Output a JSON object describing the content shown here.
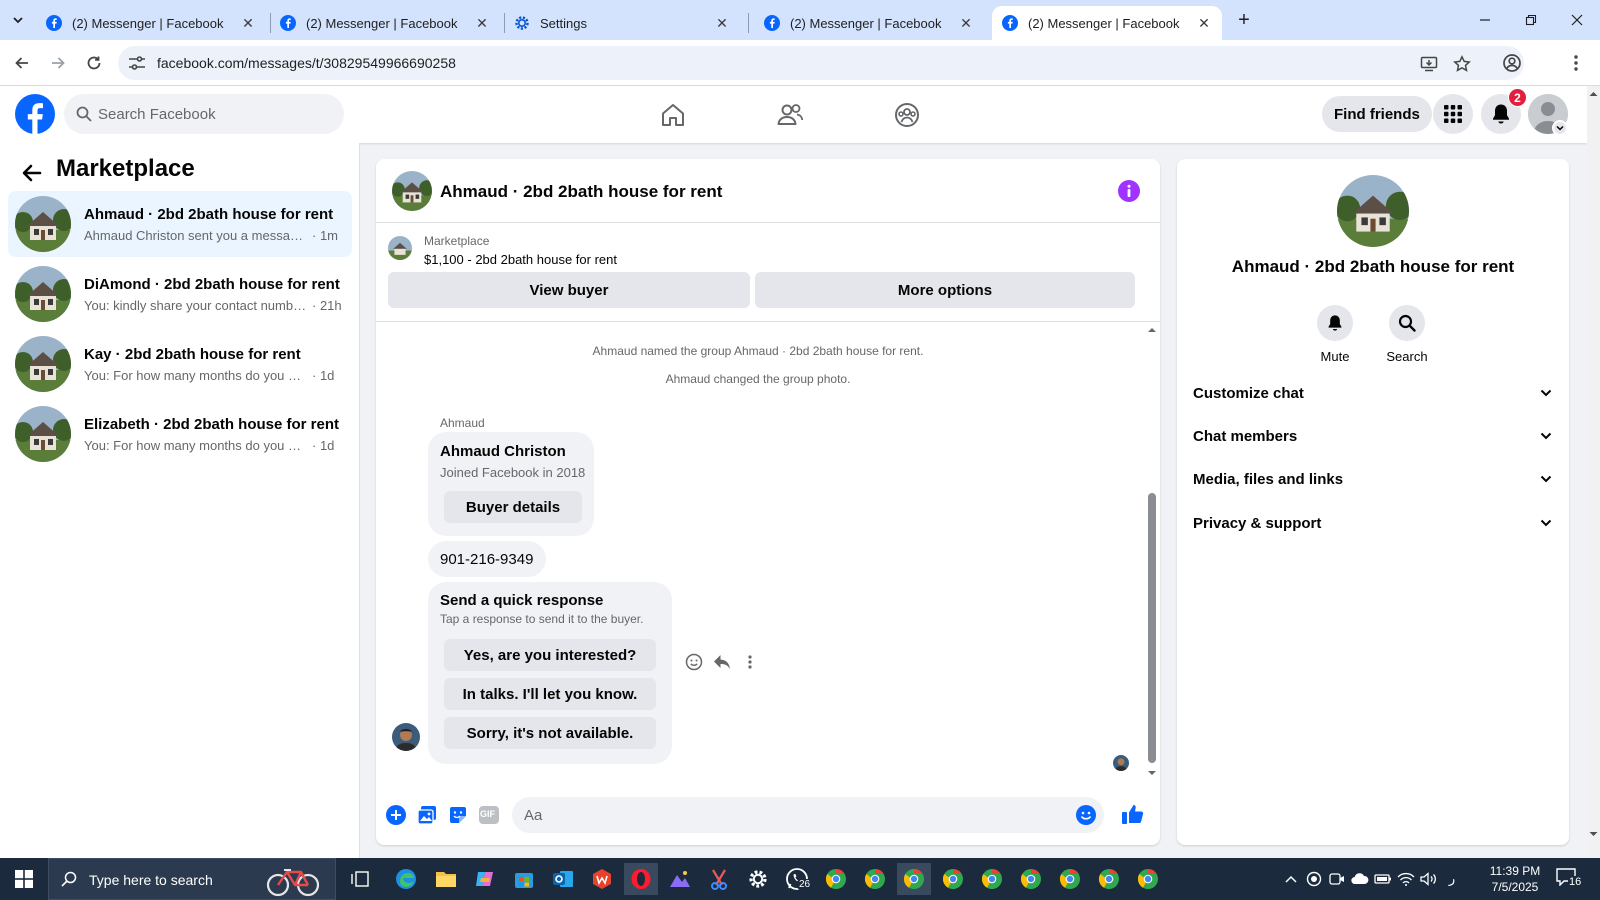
{
  "browser": {
    "tabs": [
      {
        "title": "(2) Messenger | Facebook",
        "icon": "facebook-icon",
        "active": false
      },
      {
        "title": "(2) Messenger | Facebook",
        "icon": "facebook-icon",
        "active": false
      },
      {
        "title": "Settings",
        "icon": "gear-icon",
        "active": false
      },
      {
        "title": "(2) Messenger | Facebook",
        "icon": "facebook-icon",
        "active": false
      },
      {
        "title": "(2) Messenger | Facebook",
        "icon": "facebook-icon",
        "active": true
      }
    ],
    "tab_close_glyph": "✕",
    "new_tab_glyph": "+",
    "url": "facebook.com/messages/t/30829549966690258"
  },
  "facebook": {
    "search_placeholder": "Search Facebook",
    "find_friends": "Find friends",
    "notification_count": "2",
    "brand_color": "#0866ff"
  },
  "marketplace": {
    "title": "Marketplace",
    "conversations": [
      {
        "name": "Ahmaud · 2bd 2bath house for rent",
        "preview": "Ahmaud Christon sent you a message about your listing",
        "time": "· 1m",
        "active": true
      },
      {
        "name": "DiAmond · 2bd 2bath house for rent",
        "preview": "You: kindly share your contact number please",
        "time": "· 21h",
        "active": false
      },
      {
        "name": "Kay · 2bd 2bath house for rent",
        "preview": "You: For how many months do you want to rent",
        "time": "· 1d",
        "active": false
      },
      {
        "name": "Elizabeth · 2bd 2bath house for rent",
        "preview": "You: For how many months do you want to rent",
        "time": "· 1d",
        "active": false
      }
    ]
  },
  "chat": {
    "title": "Ahmaud · 2bd 2bath house for rent",
    "listing_source": "Marketplace",
    "listing_price_title": "$1,100 - 2bd 2bath house for rent",
    "view_buyer": "View buyer",
    "more_options": "More options",
    "system_messages": [
      "Ahmaud named the group Ahmaud · 2bd 2bath house for rent.",
      "Ahmaud changed the group photo."
    ],
    "sender_label": "Ahmaud",
    "buyer_card": {
      "name": "Ahmaud Christon",
      "joined": "Joined Facebook in 2018",
      "button": "Buyer details"
    },
    "phone_message": "901-216-9349",
    "quick_response": {
      "title": "Send a quick response",
      "subtitle": "Tap a response to send it to the buyer.",
      "options": [
        "Yes, are you interested?",
        "In talks. I'll let you know.",
        "Sorry, it's not available."
      ]
    },
    "composer_placeholder": "Aa",
    "gif_label": "GIF"
  },
  "info_panel": {
    "title": "Ahmaud · 2bd 2bath house for rent",
    "actions": [
      {
        "label": "Mute",
        "icon": "bell-icon"
      },
      {
        "label": "Search",
        "icon": "search-icon"
      }
    ],
    "sections": [
      "Customize chat",
      "Chat members",
      "Media, files and links",
      "Privacy & support"
    ]
  },
  "taskbar": {
    "search_placeholder": "Type here to search",
    "whatsapp_badge": "26",
    "time": "11:39 PM",
    "date": "7/5/2025",
    "notification_count": "16",
    "keyboard_indicator": "ﺭ"
  }
}
